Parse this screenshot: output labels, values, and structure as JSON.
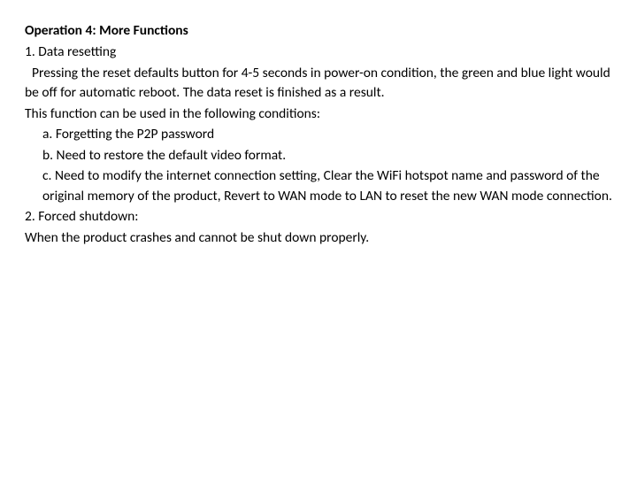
{
  "doc": {
    "title": "Operation 4: More Functions",
    "section1": {
      "heading": "1. Data resetting",
      "para1": "Pressing the reset defaults button for 4-5 seconds in power-on condition, the green and blue light would be off for automatic reboot. The data reset is finished as a result.",
      "para2": "This function can be used in the following conditions:",
      "a": "a. Forgetting the P2P password",
      "b": "b. Need to restore the default video format.",
      "c": "c. Need to modify the internet connection setting, Clear the WiFi hotspot name and password of the original memory of the product, Revert to WAN mode to LAN to reset the new WAN mode connection."
    },
    "section2": {
      "heading": "2. Forced shutdown:",
      "para1": "When the product crashes and cannot be shut down properly."
    }
  }
}
